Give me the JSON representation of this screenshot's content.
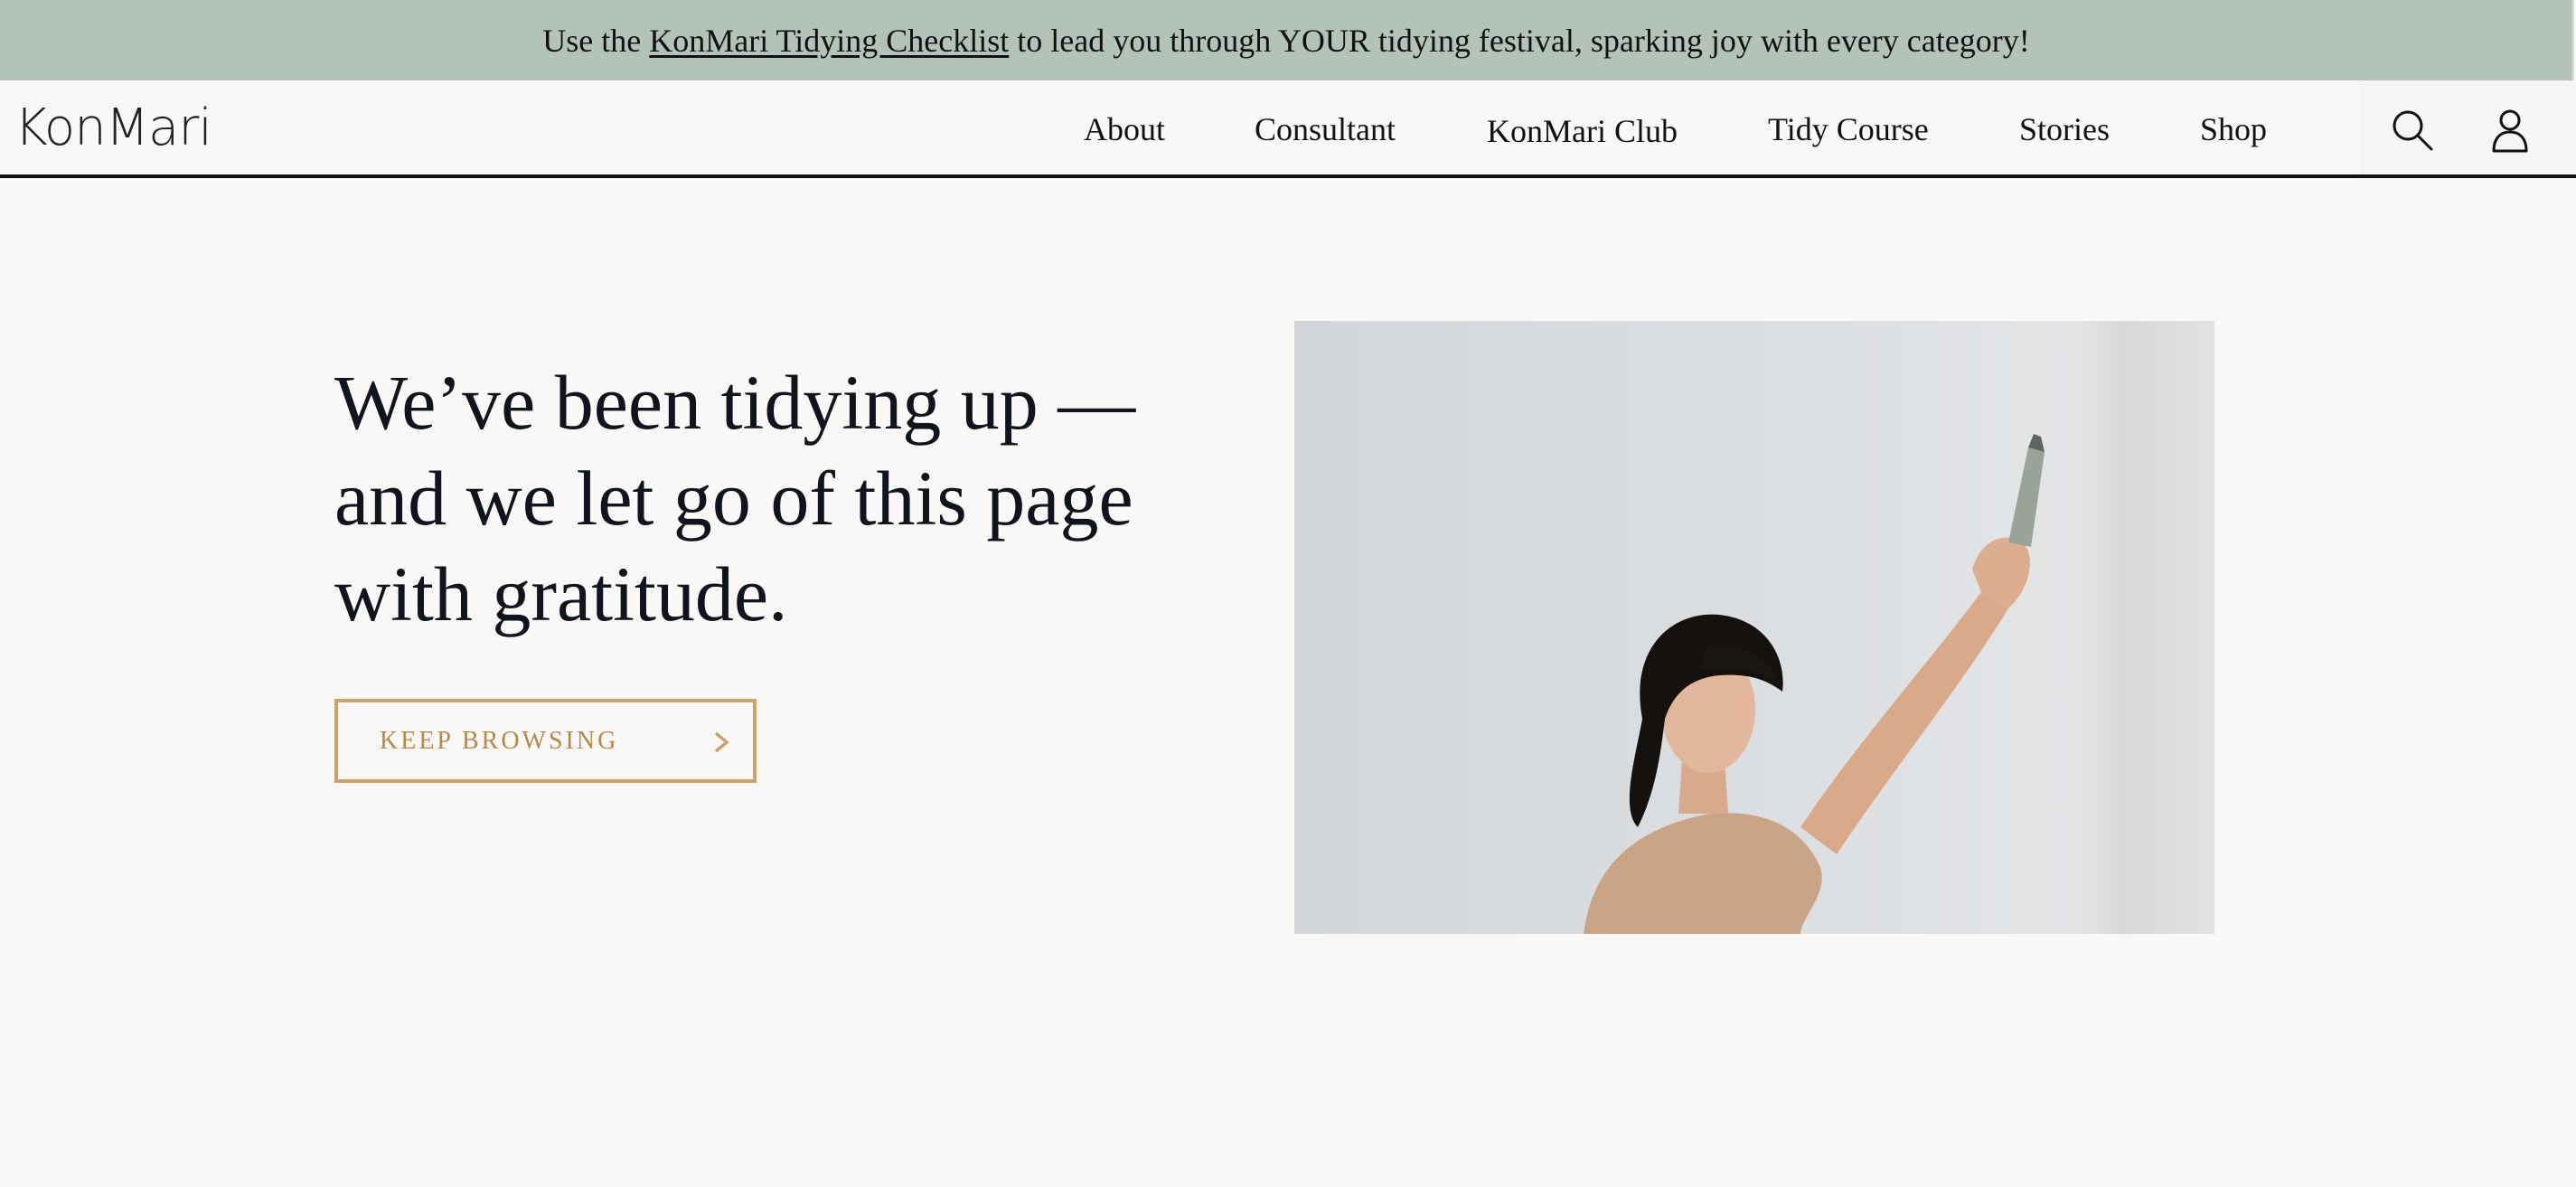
{
  "announcement": {
    "prefix": "Use the ",
    "link": "KonMari Tidying Checklist",
    "suffix": " to lead you through YOUR tidying festival, sparking joy with every category!"
  },
  "header": {
    "logo": "KonMari",
    "nav": [
      "About",
      "Consultant",
      "KonMari Club",
      "Tidy Course",
      "Stories",
      "Shop"
    ],
    "icons": [
      "search-icon",
      "account-icon"
    ]
  },
  "hero": {
    "title": "We’ve been tidying up — and we let go of this page with gratitude.",
    "cta_label": "KEEP BROWSING",
    "cta_icon": "chevron-right-icon"
  },
  "colors": {
    "banner": "#b4c3ba",
    "background": "#faf8f6",
    "accent": "#c9a36a",
    "text": "#10141c"
  }
}
